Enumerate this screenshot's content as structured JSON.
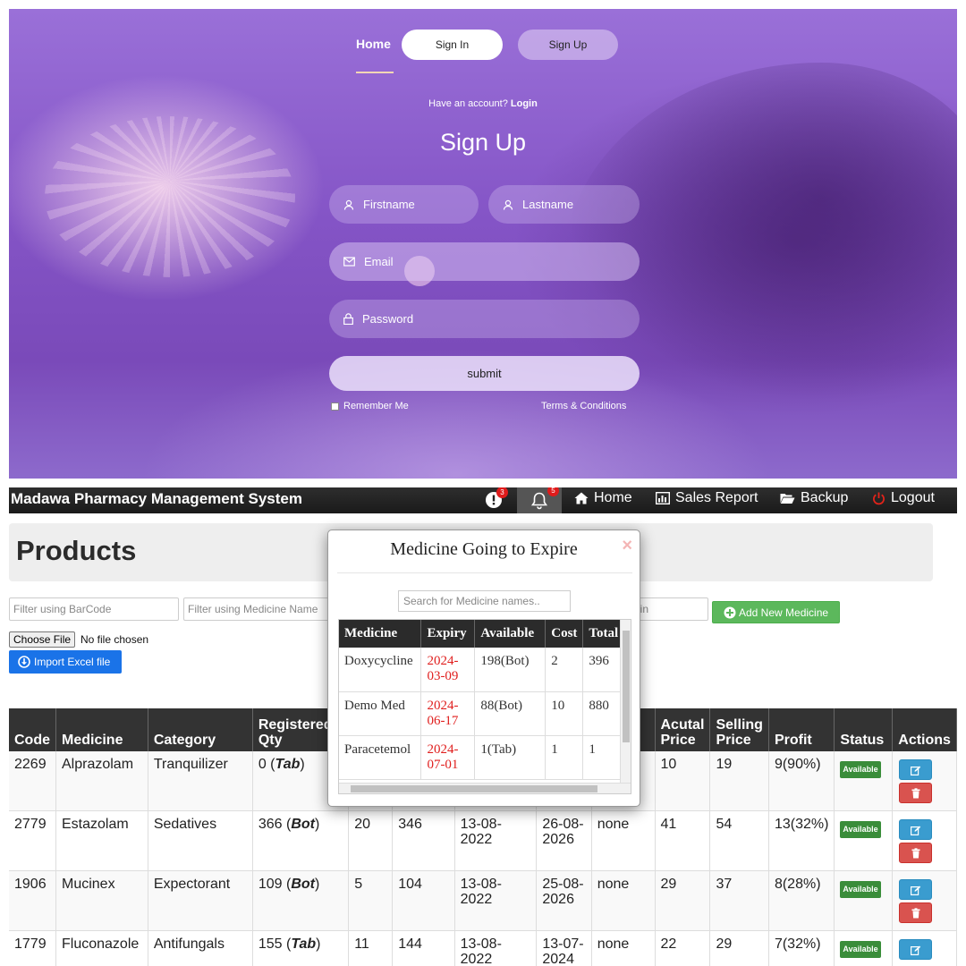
{
  "signup": {
    "nav": {
      "home": "Home",
      "sign_in": "Sign In",
      "sign_up": "Sign Up"
    },
    "have_account": "Have an account?",
    "login_link": "Login",
    "title": "Sign Up",
    "firstname_placeholder": "Firstname",
    "lastname_placeholder": "Lastname",
    "email_placeholder": "Email",
    "password_placeholder": "Password",
    "submit": "submit",
    "remember_me": "Remember Me",
    "terms": "Terms & Conditions"
  },
  "pharmacy": {
    "brand": "Madawa Pharmacy Management System",
    "alerts_count": "3",
    "notifications_count": "5",
    "nav": {
      "home": "Home",
      "sales_report": "Sales Report",
      "backup": "Backup",
      "logout": "Logout"
    },
    "page_title": "Products",
    "filters": {
      "barcode": "Filter using BarCode",
      "medicine": "Filter using Medicine Name",
      "margin": "rgin"
    },
    "add_new": "Add New Medicine",
    "choose_file": "Choose File",
    "no_file": "No file chosen",
    "import_excel": "Import Excel file",
    "table": {
      "headers": [
        "Code",
        "Medicine",
        "Category",
        "Registered Qty",
        "",
        "",
        "",
        "",
        "ark",
        "Acutal Price",
        "Selling Price",
        "Profit",
        "Status",
        "Actions"
      ],
      "status_label": "Available",
      "rows": [
        {
          "code": "2269",
          "medicine": "Alprazolam",
          "category": "Tranquilizer",
          "qty": "0",
          "unit": "Tab",
          "c5": "",
          "c6": "",
          "c7": "",
          "c8": "",
          "remark": "",
          "actual": "10",
          "selling": "19",
          "profit": "9(90%)"
        },
        {
          "code": "2779",
          "medicine": "Estazolam",
          "category": "Sedatives",
          "qty": "366",
          "unit": "Bot",
          "c5": "20",
          "c6": "346",
          "c7": "13-08-2022",
          "c8": "26-08-2026",
          "remark": "none",
          "actual": "41",
          "selling": "54",
          "profit": "13(32%)"
        },
        {
          "code": "1906",
          "medicine": "Mucinex",
          "category": "Expectorant",
          "qty": "109",
          "unit": "Bot",
          "c5": "5",
          "c6": "104",
          "c7": "13-08-2022",
          "c8": "25-08-2026",
          "remark": "none",
          "actual": "29",
          "selling": "37",
          "profit": "8(28%)"
        },
        {
          "code": "1779",
          "medicine": "Fluconazole",
          "category": "Antifungals",
          "qty": "155",
          "unit": "Tab",
          "c5": "11",
          "c6": "144",
          "c7": "13-08-2022",
          "c8": "13-07-2024",
          "remark": "none",
          "actual": "22",
          "selling": "29",
          "profit": "7(32%)"
        }
      ]
    }
  },
  "modal": {
    "title": "Medicine Going to Expire",
    "close": "×",
    "search_placeholder": "Search for Medicine names..",
    "headers": [
      "Medicine",
      "Expiry",
      "Available",
      "Cost",
      "Total"
    ],
    "rows": [
      {
        "medicine": "Doxycycline",
        "expiry": "2024-03-09",
        "available": "198(Bot)",
        "cost": "2",
        "total": "396"
      },
      {
        "medicine": "Demo Med",
        "expiry": "2024-06-17",
        "available": "88(Bot)",
        "cost": "10",
        "total": "880"
      },
      {
        "medicine": "Paracetemol",
        "expiry": "2024-07-01",
        "available": "1(Tab)",
        "cost": "1",
        "total": "1"
      }
    ]
  }
}
